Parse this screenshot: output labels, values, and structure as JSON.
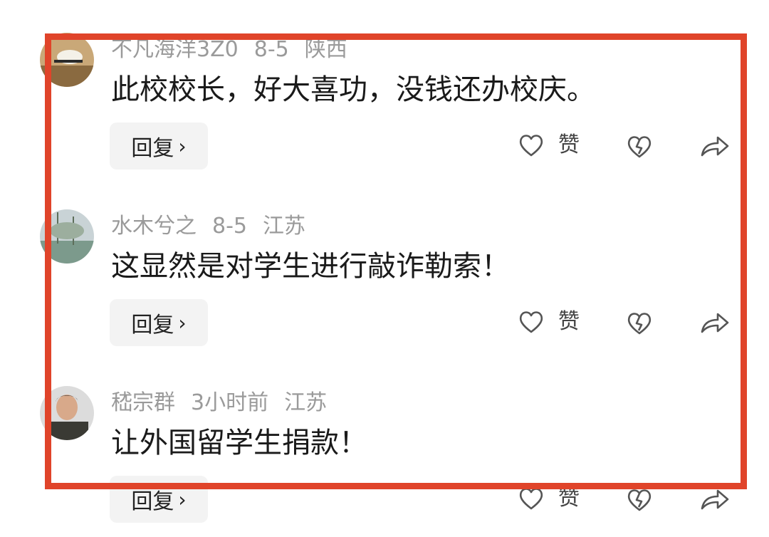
{
  "comments": [
    {
      "username": "不凡海洋3Z0",
      "time": "8-5",
      "location": "陕西",
      "text": "此校校长，好大喜功，没钱还办校庆。",
      "reply_label": "回复",
      "like_label": "赞"
    },
    {
      "username": "水木兮之",
      "time": "8-5",
      "location": "江苏",
      "text": "这显然是对学生进行敲诈勒索！",
      "reply_label": "回复",
      "like_label": "赞"
    },
    {
      "username": "嵇宗群",
      "time": "3小时前",
      "location": "江苏",
      "text": "让外国留学生捐款！",
      "reply_label": "回复",
      "like_label": "赞"
    }
  ],
  "icons": {
    "chevron": "chevron-right-icon",
    "like": "heart-icon",
    "dislike": "broken-heart-icon",
    "share": "share-arrow-icon"
  },
  "colors": {
    "highlight_frame": "#e0442a",
    "meta_text": "#9a9a9a",
    "icon": "#555555"
  }
}
